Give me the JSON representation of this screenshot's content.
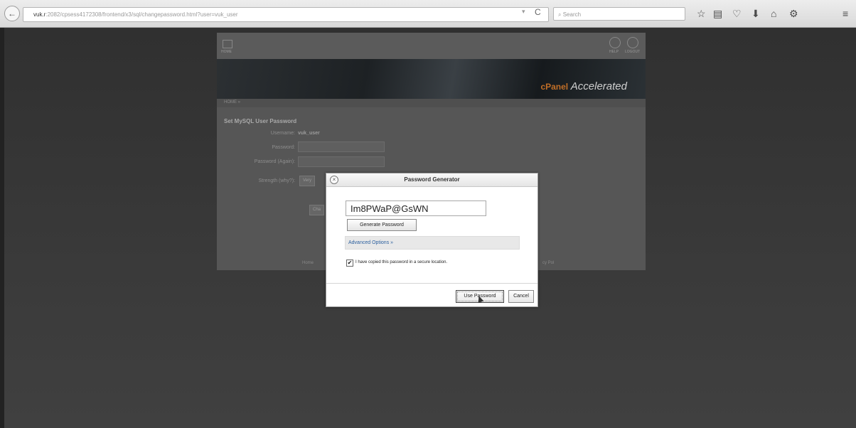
{
  "browser": {
    "url_host": "vuk.r",
    "url_rest": ":2082/cpsess4172308/frontend/x3/sql/changepassword.html?user=vuk_user",
    "search_placeholder": "Search",
    "back_glyph": "←",
    "forward_glyph": "⟳",
    "reload_glyph": "C",
    "dropdown_glyph": "▾",
    "icons": [
      "star-icon",
      "clipboard-icon",
      "pocket-icon",
      "download-icon",
      "home-icon",
      "addon-icon",
      "menu-icon"
    ],
    "icon_glyphs": [
      "☆",
      "▤",
      "♡",
      "⬇",
      "⌂",
      "⚙",
      "≡"
    ]
  },
  "cpanel": {
    "home_label": "HOME",
    "tool_labels": [
      "HELP",
      "LOGOUT"
    ],
    "brand_prefix": "cPanel",
    "brand": "Accelerated",
    "breadcrumb": "HOME »",
    "heading": "Set MySQL User Password",
    "form": {
      "username_label": "Username:",
      "username_value": "vuk_user",
      "password_label": "Password:",
      "password_again_label": "Password (Again):",
      "strength_label": "Strength (why?):",
      "strength_value": "Very",
      "change_button": "Cha"
    },
    "footer_left": "Home",
    "footer_right": "cy Pol"
  },
  "dialog": {
    "title": "Password Generator",
    "close_glyph": "×",
    "password_value": "Im8PWaP@GsWN",
    "generate_label": "Generate Password",
    "advanced_label": "Advanced Options »",
    "checkbox_checked": true,
    "checkbox_glyph": "✔",
    "checkbox_label": "I have copied this password in a secure location.",
    "use_label": "Use Password",
    "cancel_label": "Cancel"
  }
}
